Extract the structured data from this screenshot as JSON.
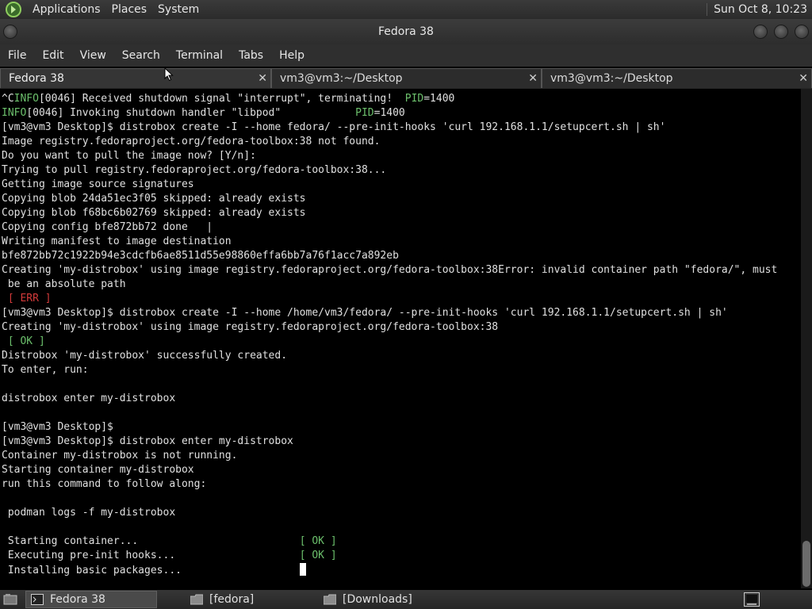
{
  "panel": {
    "menus": [
      "Applications",
      "Places",
      "System"
    ],
    "clock": "Sun Oct 8, 10:23"
  },
  "window": {
    "title": "Fedora 38"
  },
  "menubar": [
    "File",
    "Edit",
    "View",
    "Search",
    "Terminal",
    "Tabs",
    "Help"
  ],
  "tabs": [
    {
      "label": "Fedora 38",
      "active": true
    },
    {
      "label": "vm3@vm3:~/Desktop",
      "active": false
    },
    {
      "label": "vm3@vm3:~/Desktop",
      "active": false
    }
  ],
  "terminal": {
    "lines": [
      "^CINFO[0046] Received shutdown signal \"interrupt\", terminating!  PID=1400",
      "INFO[0046] Invoking shutdown handler \"libpod\"            PID=1400",
      "[vm3@vm3 Desktop]$ distrobox create -I --home fedora/ --pre-init-hooks 'curl 192.168.1.1/setupcert.sh | sh'",
      "Image registry.fedoraproject.org/fedora-toolbox:38 not found.",
      "Do you want to pull the image now? [Y/n]:",
      "Trying to pull registry.fedoraproject.org/fedora-toolbox:38...",
      "Getting image source signatures",
      "Copying blob 24da51ec3f05 skipped: already exists",
      "Copying blob f68bc6b02769 skipped: already exists",
      "Copying config bfe872bb72 done   |",
      "Writing manifest to image destination",
      "bfe872bb72c1922b94e3cdcfb6ae8511d55e98860effa6bb7a76f1acc7a892eb",
      "Creating 'my-distrobox' using image registry.fedoraproject.org/fedora-toolbox:38Error: invalid container path \"fedora/\", must",
      " be an absolute path",
      " [ ERR ]",
      "[vm3@vm3 Desktop]$ distrobox create -I --home /home/vm3/fedora/ --pre-init-hooks 'curl 192.168.1.1/setupcert.sh | sh'",
      "Creating 'my-distrobox' using image registry.fedoraproject.org/fedora-toolbox:38",
      " [ OK ]",
      "Distrobox 'my-distrobox' successfully created.",
      "To enter, run:",
      "",
      "distrobox enter my-distrobox",
      "",
      "[vm3@vm3 Desktop]$",
      "[vm3@vm3 Desktop]$ distrobox enter my-distrobox",
      "Container my-distrobox is not running.",
      "Starting container my-distrobox",
      "run this command to follow along:",
      "",
      " podman logs -f my-distrobox",
      "",
      " Starting container...                          [ OK ]",
      " Executing pre-init hooks...                    [ OK ]",
      " Installing basic packages...                   "
    ]
  },
  "taskbar": [
    {
      "label": "Fedora 38",
      "active": true
    },
    {
      "label": "[fedora]",
      "active": false
    },
    {
      "label": "[Downloads]",
      "active": false
    }
  ],
  "colors": {
    "ok": "#6cc06c",
    "err": "#d23a3a",
    "terminal_bg": "#000000"
  }
}
